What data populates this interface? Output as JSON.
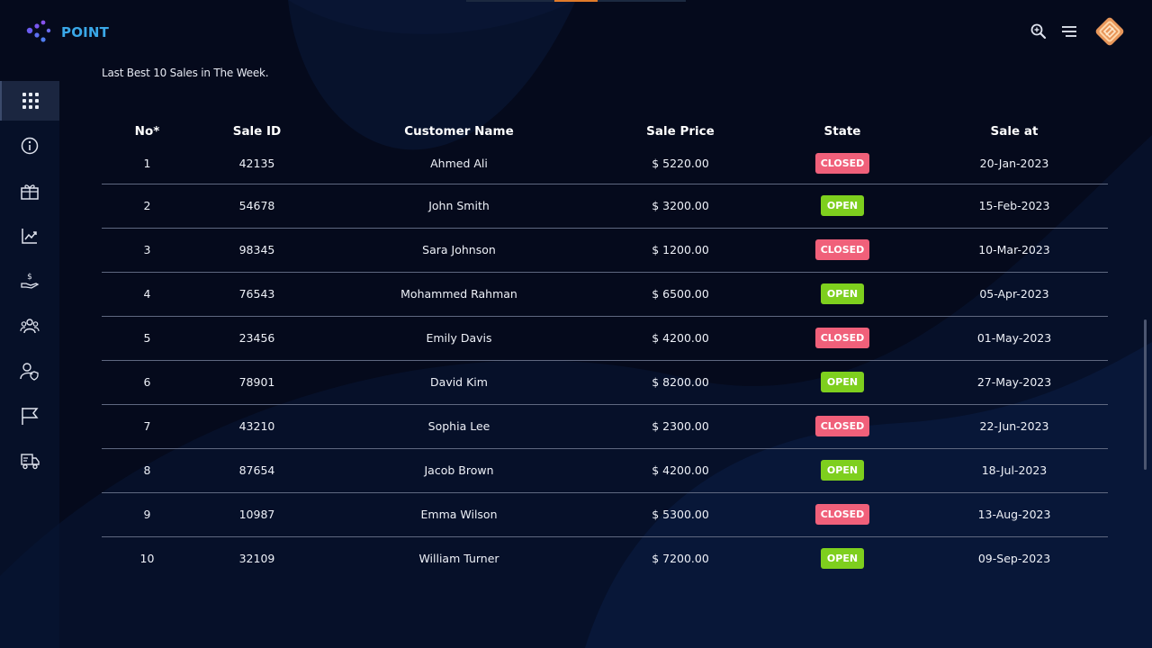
{
  "brand": {
    "name": "POINT"
  },
  "colors": {
    "bg": "#050a1c",
    "brand": "#3aa8e8",
    "closed": "#f0607a",
    "open": "#7ecf1e",
    "accent": "#e07b2a"
  },
  "header": {
    "icons": [
      "zoom-in-icon",
      "hamburger-menu-icon",
      "avatar"
    ]
  },
  "sidebar": {
    "items": [
      {
        "icon": "grid-icon",
        "active": true
      },
      {
        "icon": "info-icon",
        "active": false
      },
      {
        "icon": "gift-icon",
        "active": false
      },
      {
        "icon": "chart-icon",
        "active": false
      },
      {
        "icon": "money-hand-icon",
        "active": false
      },
      {
        "icon": "group-icon",
        "active": false
      },
      {
        "icon": "user-shield-icon",
        "active": false
      },
      {
        "icon": "flag-icon",
        "active": false
      },
      {
        "icon": "delivery-truck-icon",
        "active": false
      }
    ]
  },
  "main": {
    "caption": "Last Best 10 Sales in The Week.",
    "table": {
      "headers": [
        "No*",
        "Sale ID",
        "Customer Name",
        "Sale Price",
        "State",
        "Sale at"
      ],
      "rows": [
        {
          "no": "1",
          "id": "42135",
          "name": "Ahmed Ali",
          "price": "$ 5220.00",
          "state": "CLOSED",
          "date": "20-Jan-2023"
        },
        {
          "no": "2",
          "id": "54678",
          "name": "John Smith",
          "price": "$ 3200.00",
          "state": "OPEN",
          "date": "15-Feb-2023"
        },
        {
          "no": "3",
          "id": "98345",
          "name": "Sara Johnson",
          "price": "$ 1200.00",
          "state": "CLOSED",
          "date": "10-Mar-2023"
        },
        {
          "no": "4",
          "id": "76543",
          "name": "Mohammed Rahman",
          "price": "$ 6500.00",
          "state": "OPEN",
          "date": "05-Apr-2023"
        },
        {
          "no": "5",
          "id": "23456",
          "name": "Emily Davis",
          "price": "$ 4200.00",
          "state": "CLOSED",
          "date": "01-May-2023"
        },
        {
          "no": "6",
          "id": "78901",
          "name": "David Kim",
          "price": "$ 8200.00",
          "state": "OPEN",
          "date": "27-May-2023"
        },
        {
          "no": "7",
          "id": "43210",
          "name": "Sophia Lee",
          "price": "$ 2300.00",
          "state": "CLOSED",
          "date": "22-Jun-2023"
        },
        {
          "no": "8",
          "id": "87654",
          "name": "Jacob Brown",
          "price": "$ 4200.00",
          "state": "OPEN",
          "date": "18-Jul-2023"
        },
        {
          "no": "9",
          "id": "10987",
          "name": "Emma Wilson",
          "price": "$ 5300.00",
          "state": "CLOSED",
          "date": "13-Aug-2023"
        },
        {
          "no": "10",
          "id": "32109",
          "name": "William Turner",
          "price": "$ 7200.00",
          "state": "OPEN",
          "date": "09-Sep-2023"
        }
      ]
    }
  }
}
